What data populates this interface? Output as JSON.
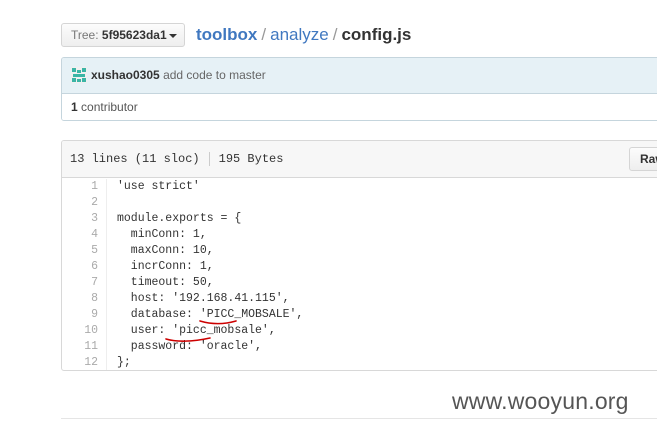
{
  "breadcrumb": {
    "tree_label": "Tree:",
    "tree_sha": "5f95623da1",
    "repo": "toolbox",
    "separator": "/",
    "folder": "analyze",
    "file": "config.js"
  },
  "commit": {
    "author": "xushao0305",
    "message": "add code to master",
    "contributors_count": "1",
    "contributors_label": "contributor"
  },
  "file": {
    "lines_info": "13 lines (11 sloc)",
    "size": "195 Bytes",
    "raw_label": "Raw"
  },
  "code_lines": [
    {
      "n": "1",
      "text": "'use strict'"
    },
    {
      "n": "2",
      "text": ""
    },
    {
      "n": "3",
      "text": "module.exports = {"
    },
    {
      "n": "4",
      "text": "  minConn: 1,"
    },
    {
      "n": "5",
      "text": "  maxConn: 10,"
    },
    {
      "n": "6",
      "text": "  incrConn: 1,"
    },
    {
      "n": "7",
      "text": "  timeout: 50,"
    },
    {
      "n": "8",
      "text": "  host: '192.168.41.115',"
    },
    {
      "n": "9",
      "text": "  database: 'PICC_MOBSALE',"
    },
    {
      "n": "10",
      "text": "  user: 'picc_mobsale',"
    },
    {
      "n": "11",
      "text": "  password: 'oracle',"
    },
    {
      "n": "12",
      "text": "};"
    }
  ],
  "annotation_color": "#cc0000",
  "accent_link": "#4078c0",
  "watermark": "www.wooyun.org"
}
